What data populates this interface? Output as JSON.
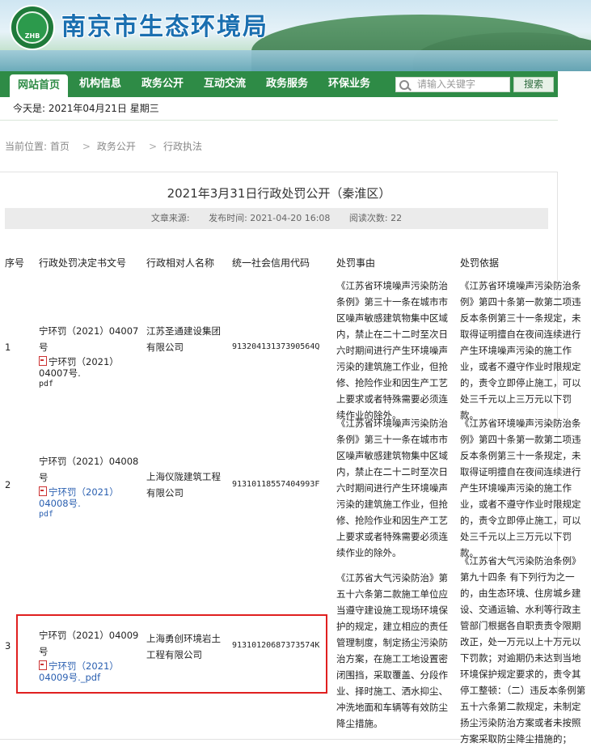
{
  "header": {
    "site_title": "南京市生态环境局",
    "logo_text": "ZHB",
    "nav": [
      "网站首页",
      "机构信息",
      "政务公开",
      "互动交流",
      "政务服务",
      "环保业务"
    ],
    "search_placeholder": "请输入关键字",
    "search_button": "搜索",
    "date": "今天是: 2021年04月21日 星期三"
  },
  "breadcrumb": [
    "当前位置: 首页",
    "政务公开",
    "行政执法"
  ],
  "article": {
    "title": "2021年3月31日行政处罚公开（秦淮区）",
    "source": "文章来源:",
    "published": "发布时间: 2021-04-20 16:08",
    "views": "阅读次数: 22"
  },
  "table": {
    "headers": [
      "序号",
      "行政处罚决定书文号",
      "行政相对人名称",
      "统一社会信用代码",
      "处罚事由",
      "处罚依据"
    ],
    "rows": [
      {
        "no": "1",
        "doc": "宁环罚（2021）04007号",
        "link": "宁环罚（2021）04007号.",
        "ext": "pdf",
        "party": "江苏圣通建设集团有限公司",
        "code": "91320413137390564Q",
        "reason": "《江苏省环境噪声污染防治条例》第三十一条在城市市区噪声敏感建筑物集中区域内，禁止在二十二时至次日六时期间进行产生环境噪声污染的建筑施工作业，但抢修、抢险作业和因生产工艺上要求或者特殊需要必须连续作业的除外。",
        "basis": "《江苏省环境噪声污染防治条例》第四十条第一款第二项违反本条例第三十一条规定，未取得证明擅自在夜间连续进行产生环境噪声污染的施工作业，或者不遵守作业时限规定的，责令立即停止施工，可以处三千元以上三万元以下罚款。"
      },
      {
        "no": "2",
        "doc": "宁环罚（2021）04008号",
        "link": "宁环罚（2021）04008号.",
        "ext": "pdf",
        "party": "上海仪陇建筑工程有限公司",
        "code": "91310118557404993F",
        "reason": "《江苏省环境噪声污染防治条例》第三十一条在城市市区噪声敏感建筑物集中区域内，禁止在二十二时至次日六时期间进行产生环境噪声污染的建筑施工作业，但抢修、抢险作业和因生产工艺上要求或者特殊需要必须连续作业的除外。",
        "basis": "《江苏省环境噪声污染防治条例》第四十条第一款第二项违反本条例第三十一条规定，未取得证明擅自在夜间连续进行产生环境噪声污染的施工作业，或者不遵守作业时限规定的，责令立即停止施工，可以处三千元以上三万元以下罚款。"
      },
      {
        "no": "3",
        "doc": "宁环罚（2021）04009号",
        "link": "宁环罚（2021）04009号._pdf",
        "ext": "",
        "party": "上海勇创环境岩土工程有限公司",
        "code": "91310120687373574K",
        "reason": "《江苏省大气污染防治》第五十六条第二款施工单位应当遵守建设施工现场环境保护的规定，建立相应的责任管理制度，制定扬尘污染防治方案，在施工工地设置密闭围挡，采取覆盖、分段作业、择时施工、洒水抑尘、冲洗地面和车辆等有效防尘降尘措施。",
        "basis": "《江苏省大气污染防治条例》第九十四条 有下列行为之一的，由生态环境、住房城乡建设、交通运输、水利等行政主管部门根据各自职责责令限期改正，处一万元以上十万元以下罚款；对逾期仍未达到当地环境保护规定要求的，责令其停工整顿：（二）违反本条例第五十六条第二款规定，未制定扬尘污染防治方案或者未按照方案采取防尘降尘措施的；"
      }
    ]
  }
}
